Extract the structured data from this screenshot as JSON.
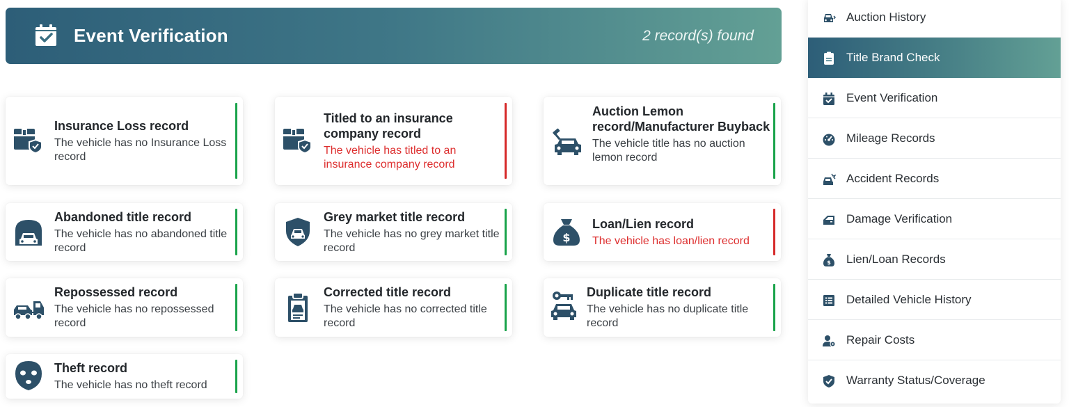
{
  "header": {
    "title": "Event Verification",
    "count": "2 record(s) found",
    "icon": "calendar-check-icon"
  },
  "colors": {
    "accent": "#2d5e78",
    "accent_end": "#63a095",
    "ok": "#19a34a",
    "bad": "#d62a2a"
  },
  "cards": [
    {
      "title": "Insurance Loss record",
      "desc": "The vehicle has no Insurance Loss record",
      "status": "ok",
      "icon": "box-shield-icon"
    },
    {
      "title": "Titled to an insurance company record",
      "desc": "The vehicle has titled to an insurance company record",
      "status": "bad",
      "icon": "box-shield-icon"
    },
    {
      "title": "Auction Lemon record/Manufacturer Buyback",
      "desc": "The vehicle title has no auction lemon record",
      "status": "ok",
      "icon": "gavel-car-icon"
    },
    {
      "title": "Abandoned title record",
      "desc": "The vehicle has no abandoned title record",
      "status": "ok",
      "icon": "garage-car-icon"
    },
    {
      "title": "Grey market title record",
      "desc": "The vehicle has no grey market title record",
      "status": "ok",
      "icon": "shield-car-icon"
    },
    {
      "title": "Loan/Lien record",
      "desc": "The vehicle has loan/lien record",
      "status": "bad",
      "icon": "money-bag-icon"
    },
    {
      "title": "Repossessed record",
      "desc": "The vehicle has no repossessed record",
      "status": "ok",
      "icon": "tow-truck-icon"
    },
    {
      "title": "Corrected title record",
      "desc": "The vehicle has no corrected title record",
      "status": "ok",
      "icon": "clipboard-car-icon"
    },
    {
      "title": "Duplicate title record",
      "desc": "The vehicle has no duplicate title record",
      "status": "ok",
      "icon": "key-car-icon"
    },
    {
      "title": "Theft record",
      "desc": "The vehicle has no theft record",
      "status": "ok",
      "icon": "thief-mask-icon"
    }
  ],
  "sidebar": {
    "items": [
      {
        "label": "Auction History",
        "icon": "car-front-icon"
      },
      {
        "label": "Title Brand Check",
        "icon": "document-icon",
        "active": true
      },
      {
        "label": "Event Verification",
        "icon": "calendar-check-icon"
      },
      {
        "label": "Mileage Records",
        "icon": "speedometer-icon"
      },
      {
        "label": "Accident Records",
        "icon": "car-crash-icon"
      },
      {
        "label": "Damage Verification",
        "icon": "car-door-icon"
      },
      {
        "label": "Lien/Loan Records",
        "icon": "money-bag-icon"
      },
      {
        "label": "Detailed Vehicle History",
        "icon": "list-icon"
      },
      {
        "label": "Repair Costs",
        "icon": "user-gear-icon"
      },
      {
        "label": "Warranty Status/Coverage",
        "icon": "shield-check-icon"
      }
    ]
  }
}
